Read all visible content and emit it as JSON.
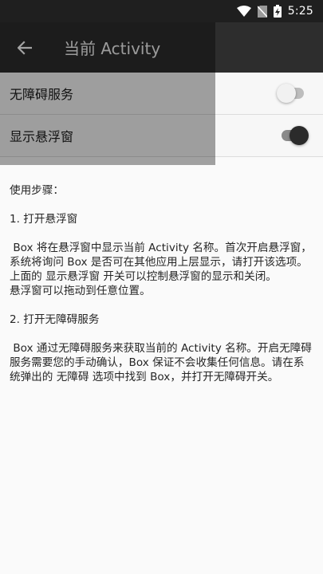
{
  "status_bar": {
    "time": "5:25",
    "icons": [
      "wifi-icon",
      "no-sim-icon",
      "battery-charging-icon"
    ]
  },
  "app_bar": {
    "back_icon": "arrow-left-icon",
    "title": "当前 Activity"
  },
  "settings": [
    {
      "label": "无障碍服务",
      "enabled": false
    },
    {
      "label": "显示悬浮窗",
      "enabled": true
    }
  ],
  "instructions": {
    "heading": "使用步骤：",
    "step1_title": "1. 打开悬浮窗",
    "step1_para1": " Box 将在悬浮窗中显示当前 Activity 名称。首次开启悬浮窗，系统将询问 Box 是否可在其他应用上层显示，请打开该选项。",
    "step1_para2": "上面的 显示悬浮窗 开关可以控制悬浮窗的显示和关闭。",
    "step1_para3": "悬浮窗可以拖动到任意位置。",
    "step2_title": "2. 打开无障碍服务",
    "step2_para1": " Box 通过无障碍服务来获取当前的 Activity 名称。开启无障碍服务需要您的手动确认，Box 保证不会收集任何信息。请在系统弹出的 无障碍 选项中找到 Box，并打开无障碍开关。"
  },
  "colors": {
    "app_bar": "#2d2d2d",
    "status_bar": "#1f1f1f",
    "background": "#fafafa",
    "switch_on_thumb": "#2b2b2b",
    "overlay": "#000000"
  }
}
